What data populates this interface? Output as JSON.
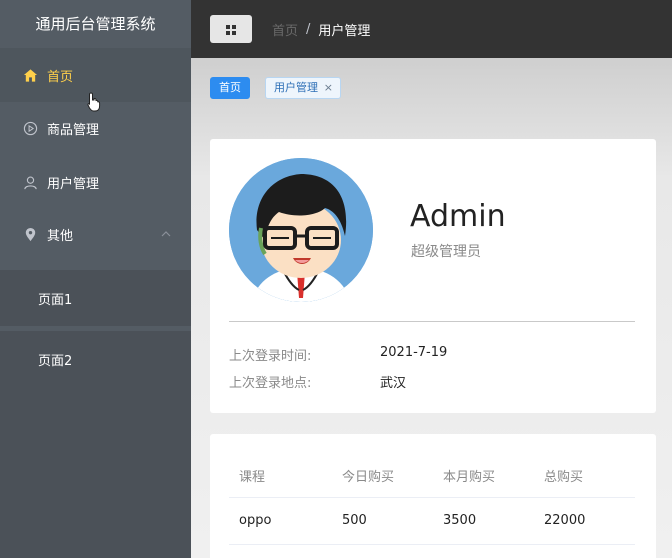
{
  "sidebar": {
    "title": "通用后台管理系统",
    "items": [
      {
        "label": "首页",
        "icon": "home-icon",
        "active": true
      },
      {
        "label": "商品管理",
        "icon": "video-play-icon"
      },
      {
        "label": "用户管理",
        "icon": "user-icon"
      },
      {
        "label": "其他",
        "icon": "location-icon",
        "expanded": true
      }
    ],
    "sub_items": [
      "页面1",
      "页面2"
    ]
  },
  "header": {
    "breadcrumb_home": "首页",
    "breadcrumb_sep": "/",
    "breadcrumb_current": "用户管理"
  },
  "tags": {
    "home": "首页",
    "user": "用户管理",
    "close": "×"
  },
  "user": {
    "name": "Admin",
    "role": "超级管理员",
    "last_login_time_label": "上次登录时间:",
    "last_login_time": "2021-7-19",
    "last_login_place_label": "上次登录地点:",
    "last_login_place": "武汉"
  },
  "table": {
    "headers": [
      "课程",
      "今日购买",
      "本月购买",
      "总购买"
    ],
    "rows": [
      [
        "oppo",
        "500",
        "3500",
        "22000"
      ]
    ]
  },
  "colors": {
    "sidebar_bg": "#545c64",
    "active": "#ffd04b",
    "header_bg": "#333333",
    "primary": "#2d8cf0"
  }
}
